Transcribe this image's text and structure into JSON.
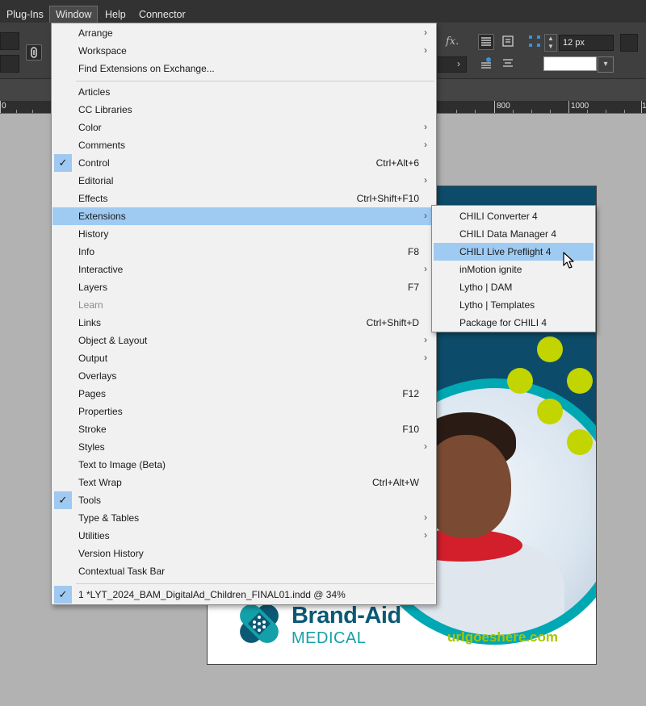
{
  "menubar": {
    "items": [
      {
        "label": "Plug-Ins"
      },
      {
        "label": "Window"
      },
      {
        "label": "Help"
      },
      {
        "label": "Connector"
      }
    ]
  },
  "control": {
    "point_size": "12 px",
    "fx_label": "fx."
  },
  "ruler": {
    "labels": [
      "0",
      "800",
      "1000",
      "1"
    ]
  },
  "window_menu": {
    "items": [
      {
        "label": "Arrange",
        "submenu": true
      },
      {
        "label": "Workspace",
        "submenu": true
      },
      {
        "label": "Find Extensions on Exchange..."
      },
      {
        "label": "Articles"
      },
      {
        "label": "CC Libraries"
      },
      {
        "label": "Color",
        "submenu": true
      },
      {
        "label": "Comments",
        "submenu": true
      },
      {
        "label": "Control",
        "shortcut": "Ctrl+Alt+6",
        "checked": true
      },
      {
        "label": "Editorial",
        "submenu": true
      },
      {
        "label": "Effects",
        "shortcut": "Ctrl+Shift+F10"
      },
      {
        "label": "Extensions",
        "submenu": true,
        "highlighted": true
      },
      {
        "label": "History"
      },
      {
        "label": "Info",
        "shortcut": "F8"
      },
      {
        "label": "Interactive",
        "submenu": true
      },
      {
        "label": "Layers",
        "shortcut": "F7"
      },
      {
        "label": "Learn",
        "disabled": true
      },
      {
        "label": "Links",
        "shortcut": "Ctrl+Shift+D"
      },
      {
        "label": "Object & Layout",
        "submenu": true
      },
      {
        "label": "Output",
        "submenu": true
      },
      {
        "label": "Overlays"
      },
      {
        "label": "Pages",
        "shortcut": "F12"
      },
      {
        "label": "Properties"
      },
      {
        "label": "Stroke",
        "shortcut": "F10"
      },
      {
        "label": "Styles",
        "submenu": true
      },
      {
        "label": "Text to Image (Beta)"
      },
      {
        "label": "Text Wrap",
        "shortcut": "Ctrl+Alt+W"
      },
      {
        "label": "Tools",
        "checked": true
      },
      {
        "label": "Type & Tables",
        "submenu": true
      },
      {
        "label": "Utilities",
        "submenu": true
      },
      {
        "label": "Version History"
      },
      {
        "label": "Contextual Task Bar"
      },
      {
        "label": "1 *LYT_2024_BAM_DigitalAd_Children_FINAL01.indd @ 34%",
        "checked": true
      }
    ],
    "submenu_arrow": "›",
    "check_glyph": "✓"
  },
  "extensions_submenu": {
    "items": [
      {
        "label": "CHILI Converter 4"
      },
      {
        "label": "CHILI Data Manager 4"
      },
      {
        "label": "CHILI Live Preflight 4",
        "highlighted": true
      },
      {
        "label": "inMotion ignite"
      },
      {
        "label": "Lytho | DAM"
      },
      {
        "label": "Lytho | Templates"
      },
      {
        "label": "Package for CHILI 4"
      }
    ]
  },
  "document": {
    "brand_name": "Brand-Aid",
    "brand_sub": "MEDICAL",
    "url": "urlgoeshere.com",
    "colors": {
      "navy": "#0c4c6a",
      "teal": "#00a8b4",
      "lime": "#c3d500",
      "brand_blue": "#0b5975"
    }
  }
}
